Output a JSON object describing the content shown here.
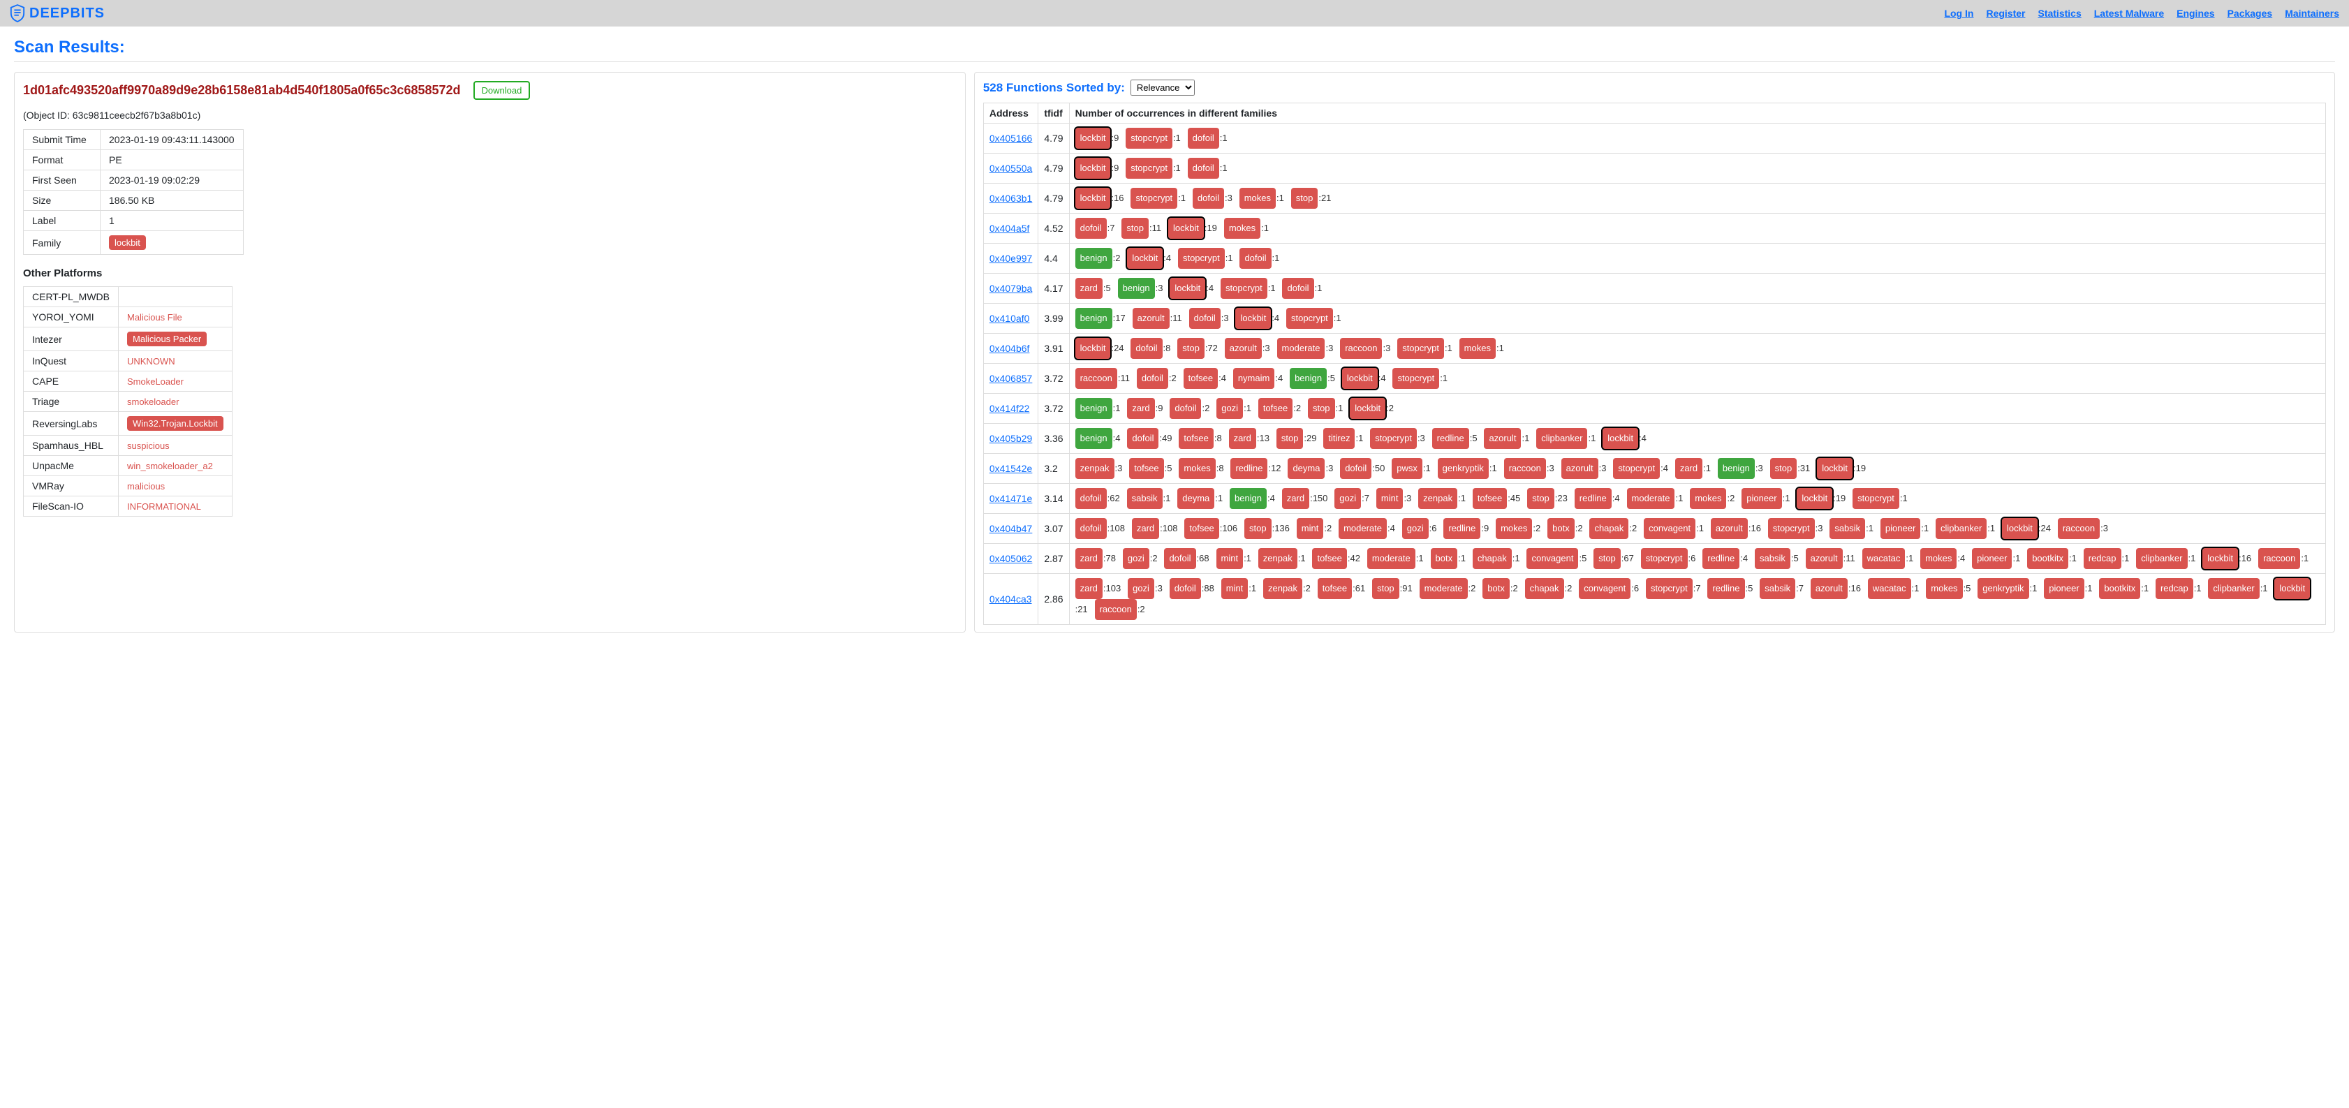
{
  "nav": {
    "brand": "DEEPBITS",
    "links": [
      "Log In",
      "Register",
      "Statistics",
      "Latest Malware",
      "Engines",
      "Packages",
      "Maintainers"
    ]
  },
  "page_title": "Scan Results:",
  "hash": "1d01afc493520aff9970a89d9e28b6158e81ab4d540f1805a0f65c3c6858572d",
  "download_label": "Download",
  "object_id_label": "(Object ID: 63c9811ceecb2f67b3a8b01c)",
  "meta": [
    {
      "k": "Submit Time",
      "v": "2023-01-19 09:43:11.143000"
    },
    {
      "k": "Format",
      "v": "PE"
    },
    {
      "k": "First Seen",
      "v": "2023-01-19 09:02:29"
    },
    {
      "k": "Size",
      "v": "186.50 KB"
    },
    {
      "k": "Label",
      "v": "1"
    },
    {
      "k": "Family",
      "v": "lockbit",
      "pill": true
    }
  ],
  "platforms_title": "Other Platforms",
  "platforms": [
    {
      "name": "CERT-PL_MWDB",
      "val": ""
    },
    {
      "name": "YOROI_YOMI",
      "val": "Malicious File",
      "style": "plain"
    },
    {
      "name": "Intezer",
      "val": "Malicious Packer",
      "style": "pill"
    },
    {
      "name": "InQuest",
      "val": "UNKNOWN",
      "style": "plain"
    },
    {
      "name": "CAPE",
      "val": "SmokeLoader",
      "style": "plain"
    },
    {
      "name": "Triage",
      "val": "smokeloader",
      "style": "plain"
    },
    {
      "name": "ReversingLabs",
      "val": "Win32.Trojan.Lockbit",
      "style": "pill"
    },
    {
      "name": "Spamhaus_HBL",
      "val": "suspicious",
      "style": "plain"
    },
    {
      "name": "UnpacMe",
      "val": "win_smokeloader_a2",
      "style": "plain"
    },
    {
      "name": "VMRay",
      "val": "malicious",
      "style": "plain"
    },
    {
      "name": "FileScan-IO",
      "val": "INFORMATIONAL",
      "style": "plain"
    }
  ],
  "functions_title_prefix": "528 Functions Sorted by:",
  "sort_options": [
    "Relevance"
  ],
  "func_headers": [
    "Address",
    "tfidf",
    "Number of occurrences in different families"
  ],
  "main_family": "lockbit",
  "functions": [
    {
      "addr": "0x405166",
      "tfidf": "4.79",
      "fams": [
        [
          "lockbit",
          9
        ],
        [
          "stopcrypt",
          1
        ],
        [
          "dofoil",
          1
        ]
      ]
    },
    {
      "addr": "0x40550a",
      "tfidf": "4.79",
      "fams": [
        [
          "lockbit",
          9
        ],
        [
          "stopcrypt",
          1
        ],
        [
          "dofoil",
          1
        ]
      ]
    },
    {
      "addr": "0x4063b1",
      "tfidf": "4.79",
      "fams": [
        [
          "lockbit",
          16
        ],
        [
          "stopcrypt",
          1
        ],
        [
          "dofoil",
          3
        ],
        [
          "mokes",
          1
        ],
        [
          "stop",
          21
        ]
      ]
    },
    {
      "addr": "0x404a5f",
      "tfidf": "4.52",
      "fams": [
        [
          "dofoil",
          7
        ],
        [
          "stop",
          11
        ],
        [
          "lockbit",
          19
        ],
        [
          "mokes",
          1
        ]
      ]
    },
    {
      "addr": "0x40e997",
      "tfidf": "4.4",
      "fams": [
        [
          "benign",
          2,
          "g"
        ],
        [
          "lockbit",
          4
        ],
        [
          "stopcrypt",
          1
        ],
        [
          "dofoil",
          1
        ]
      ]
    },
    {
      "addr": "0x4079ba",
      "tfidf": "4.17",
      "fams": [
        [
          "zard",
          5
        ],
        [
          "benign",
          3,
          "g"
        ],
        [
          "lockbit",
          4
        ],
        [
          "stopcrypt",
          1
        ],
        [
          "dofoil",
          1
        ]
      ]
    },
    {
      "addr": "0x410af0",
      "tfidf": "3.99",
      "fams": [
        [
          "benign",
          17,
          "g"
        ],
        [
          "azorult",
          11
        ],
        [
          "dofoil",
          3
        ],
        [
          "lockbit",
          4
        ],
        [
          "stopcrypt",
          1
        ]
      ]
    },
    {
      "addr": "0x404b6f",
      "tfidf": "3.91",
      "fams": [
        [
          "lockbit",
          24
        ],
        [
          "dofoil",
          8
        ],
        [
          "stop",
          72
        ],
        [
          "azorult",
          3
        ],
        [
          "moderate",
          3
        ],
        [
          "raccoon",
          3
        ],
        [
          "stopcrypt",
          1
        ],
        [
          "mokes",
          1
        ]
      ]
    },
    {
      "addr": "0x406857",
      "tfidf": "3.72",
      "fams": [
        [
          "raccoon",
          11
        ],
        [
          "dofoil",
          2
        ],
        [
          "tofsee",
          4
        ],
        [
          "nymaim",
          4
        ],
        [
          "benign",
          5,
          "g"
        ],
        [
          "lockbit",
          4
        ],
        [
          "stopcrypt",
          1
        ]
      ]
    },
    {
      "addr": "0x414f22",
      "tfidf": "3.72",
      "fams": [
        [
          "benign",
          1,
          "g"
        ],
        [
          "zard",
          9
        ],
        [
          "dofoil",
          2
        ],
        [
          "gozi",
          1
        ],
        [
          "tofsee",
          2
        ],
        [
          "stop",
          1
        ],
        [
          "lockbit",
          2
        ]
      ]
    },
    {
      "addr": "0x405b29",
      "tfidf": "3.36",
      "fams": [
        [
          "benign",
          4,
          "g"
        ],
        [
          "dofoil",
          49
        ],
        [
          "tofsee",
          8
        ],
        [
          "zard",
          13
        ],
        [
          "stop",
          29
        ],
        [
          "titirez",
          1
        ],
        [
          "stopcrypt",
          3
        ],
        [
          "redline",
          5
        ],
        [
          "azorult",
          1
        ],
        [
          "clipbanker",
          1
        ],
        [
          "lockbit",
          4
        ]
      ]
    },
    {
      "addr": "0x41542e",
      "tfidf": "3.2",
      "fams": [
        [
          "zenpak",
          3
        ],
        [
          "tofsee",
          5
        ],
        [
          "mokes",
          8
        ],
        [
          "redline",
          12
        ],
        [
          "deyma",
          3
        ],
        [
          "dofoil",
          50
        ],
        [
          "pwsx",
          1
        ],
        [
          "genkryptik",
          1
        ],
        [
          "raccoon",
          3
        ],
        [
          "azorult",
          3
        ],
        [
          "stopcrypt",
          4
        ],
        [
          "zard",
          1
        ],
        [
          "benign",
          3,
          "g"
        ],
        [
          "stop",
          31
        ],
        [
          "lockbit",
          19
        ]
      ]
    },
    {
      "addr": "0x41471e",
      "tfidf": "3.14",
      "fams": [
        [
          "dofoil",
          62
        ],
        [
          "sabsik",
          1
        ],
        [
          "deyma",
          1
        ],
        [
          "benign",
          4,
          "g"
        ],
        [
          "zard",
          150
        ],
        [
          "gozi",
          7
        ],
        [
          "mint",
          3
        ],
        [
          "zenpak",
          1
        ],
        [
          "tofsee",
          45
        ],
        [
          "stop",
          23
        ],
        [
          "redline",
          4
        ],
        [
          "moderate",
          1
        ],
        [
          "mokes",
          2
        ],
        [
          "pioneer",
          1
        ],
        [
          "lockbit",
          19
        ],
        [
          "stopcrypt",
          1
        ]
      ]
    },
    {
      "addr": "0x404b47",
      "tfidf": "3.07",
      "fams": [
        [
          "dofoil",
          108
        ],
        [
          "zard",
          108
        ],
        [
          "tofsee",
          106
        ],
        [
          "stop",
          136
        ],
        [
          "mint",
          2
        ],
        [
          "moderate",
          4
        ],
        [
          "gozi",
          6
        ],
        [
          "redline",
          9
        ],
        [
          "mokes",
          2
        ],
        [
          "botx",
          2
        ],
        [
          "chapak",
          2
        ],
        [
          "convagent",
          1
        ],
        [
          "azorult",
          16
        ],
        [
          "stopcrypt",
          3
        ],
        [
          "sabsik",
          1
        ],
        [
          "pioneer",
          1
        ],
        [
          "clipbanker",
          1
        ],
        [
          "lockbit",
          24
        ],
        [
          "raccoon",
          3
        ]
      ]
    },
    {
      "addr": "0x405062",
      "tfidf": "2.87",
      "fams": [
        [
          "zard",
          78
        ],
        [
          "gozi",
          2
        ],
        [
          "dofoil",
          68
        ],
        [
          "mint",
          1
        ],
        [
          "zenpak",
          1
        ],
        [
          "tofsee",
          42
        ],
        [
          "moderate",
          1
        ],
        [
          "botx",
          1
        ],
        [
          "chapak",
          1
        ],
        [
          "convagent",
          5
        ],
        [
          "stop",
          67
        ],
        [
          "stopcrypt",
          6
        ],
        [
          "redline",
          4
        ],
        [
          "sabsik",
          5
        ],
        [
          "azorult",
          11
        ],
        [
          "wacatac",
          1
        ],
        [
          "mokes",
          4
        ],
        [
          "pioneer",
          1
        ],
        [
          "bootkitx",
          1
        ],
        [
          "redcap",
          1
        ],
        [
          "clipbanker",
          1
        ],
        [
          "lockbit",
          16
        ],
        [
          "raccoon",
          1
        ]
      ]
    },
    {
      "addr": "0x404ca3",
      "tfidf": "2.86",
      "fams": [
        [
          "zard",
          103
        ],
        [
          "gozi",
          3
        ],
        [
          "dofoil",
          88
        ],
        [
          "mint",
          1
        ],
        [
          "zenpak",
          2
        ],
        [
          "tofsee",
          61
        ],
        [
          "stop",
          91
        ],
        [
          "moderate",
          2
        ],
        [
          "botx",
          2
        ],
        [
          "chapak",
          2
        ],
        [
          "convagent",
          6
        ],
        [
          "stopcrypt",
          7
        ],
        [
          "redline",
          5
        ],
        [
          "sabsik",
          7
        ],
        [
          "azorult",
          16
        ],
        [
          "wacatac",
          1
        ],
        [
          "mokes",
          5
        ],
        [
          "genkryptik",
          1
        ],
        [
          "pioneer",
          1
        ],
        [
          "bootkitx",
          1
        ],
        [
          "redcap",
          1
        ],
        [
          "clipbanker",
          1
        ],
        [
          "lockbit",
          21
        ],
        [
          "raccoon",
          2
        ]
      ]
    }
  ]
}
